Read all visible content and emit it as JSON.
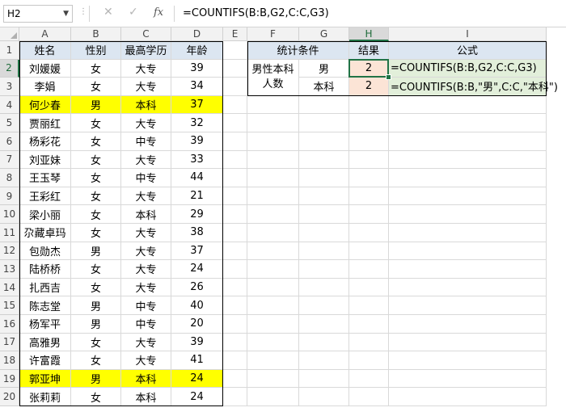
{
  "formula_bar": {
    "name_box": "H2",
    "formula": "=COUNTIFS(B:B,G2,C:C,G3)",
    "cancel_icon": "cancel-icon",
    "enter_icon": "check-icon",
    "fx_label": "fx"
  },
  "columns": [
    "A",
    "B",
    "C",
    "D",
    "E",
    "F",
    "G",
    "H",
    "I"
  ],
  "rows": [
    "1",
    "2",
    "3",
    "4",
    "5",
    "6",
    "7",
    "8",
    "9",
    "10",
    "11",
    "12",
    "13",
    "14",
    "15",
    "16",
    "17",
    "18",
    "19",
    "20"
  ],
  "colors": {
    "header_fill": "#dce6f1",
    "highlight_yellow": "#ffff00",
    "result_fill": "#fce4d6",
    "formula_fill": "#e2efda",
    "selection": "#217346"
  },
  "table": {
    "headers": [
      "姓名",
      "性别",
      "最高学历",
      "年龄"
    ],
    "rows": [
      [
        "刘媛媛",
        "女",
        "大专",
        "39"
      ],
      [
        "李娟",
        "女",
        "大专",
        "34"
      ],
      [
        "何少春",
        "男",
        "本科",
        "37"
      ],
      [
        "贾丽红",
        "女",
        "大专",
        "32"
      ],
      [
        "杨彩花",
        "女",
        "中专",
        "39"
      ],
      [
        "刘亚妹",
        "女",
        "大专",
        "33"
      ],
      [
        "王玉琴",
        "女",
        "中专",
        "44"
      ],
      [
        "王彩红",
        "女",
        "大专",
        "21"
      ],
      [
        "梁小丽",
        "女",
        "本科",
        "29"
      ],
      [
        "尕藏卓玛",
        "女",
        "大专",
        "38"
      ],
      [
        "包勋杰",
        "男",
        "大专",
        "37"
      ],
      [
        "陆桥桥",
        "女",
        "大专",
        "24"
      ],
      [
        "扎西吉",
        "女",
        "大专",
        "26"
      ],
      [
        "陈志堂",
        "男",
        "中专",
        "40"
      ],
      [
        "杨军平",
        "男",
        "中专",
        "20"
      ],
      [
        "高雅男",
        "女",
        "大专",
        "39"
      ],
      [
        "许富霞",
        "女",
        "大专",
        "41"
      ],
      [
        "郭亚坤",
        "男",
        "本科",
        "24"
      ],
      [
        "张莉莉",
        "女",
        "本科",
        "24"
      ]
    ],
    "highlight_rows": [
      2,
      17
    ]
  },
  "stats": {
    "header_condition": "统计条件",
    "header_result": "结果",
    "header_formula": "公式",
    "label_line1": "男性本科",
    "label_line2": "人数",
    "g2": "男",
    "g3": "本科",
    "h2": "2",
    "h3": "2",
    "i2": "=COUNTIFS(B:B,G2,C:C,G3)",
    "i3": "=COUNTIFS(B:B,\"男\",C:C,\"本科\")"
  }
}
